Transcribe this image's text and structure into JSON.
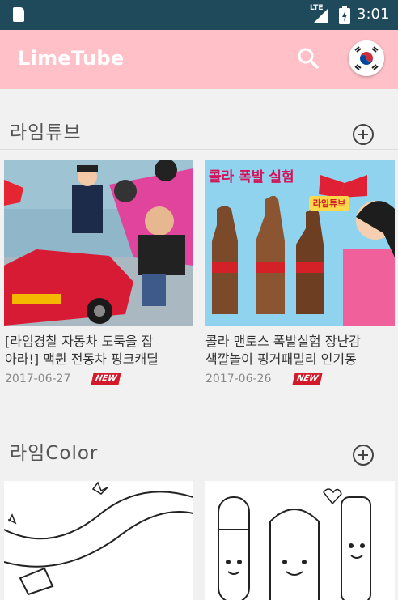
{
  "status_bar": {
    "network": "LTE",
    "time": "3:01"
  },
  "app_bar": {
    "title": "LimeTube",
    "search_icon": "search-icon",
    "flag_icon": "korea-flag-icon"
  },
  "sections": [
    {
      "title": "라임튜브",
      "add_icon": "add-circle-icon",
      "videos": [
        {
          "title_line1": "[라임경찰 자동차 도둑을 잡",
          "title_line2": "아라!] 맥퀸 전동차 핑크캐딜",
          "date": "2017-06-27",
          "badge": "NEW"
        },
        {
          "title_line1": "콜라 맨토스 폭발실험 장난감",
          "title_line2": "색깔놀이 핑거패밀리 인기동",
          "date": "2017-06-26",
          "badge": "NEW",
          "thumb_text": "콜라 폭발 실험",
          "thumb_logo": "라임튜브"
        }
      ]
    },
    {
      "title": "라임Color",
      "add_icon": "add-circle-icon",
      "videos": [
        {},
        {}
      ]
    }
  ],
  "colors": {
    "status_bar": "#1e4a5c",
    "app_bar": "#ffc0c8",
    "badge": "#d21a2a"
  }
}
